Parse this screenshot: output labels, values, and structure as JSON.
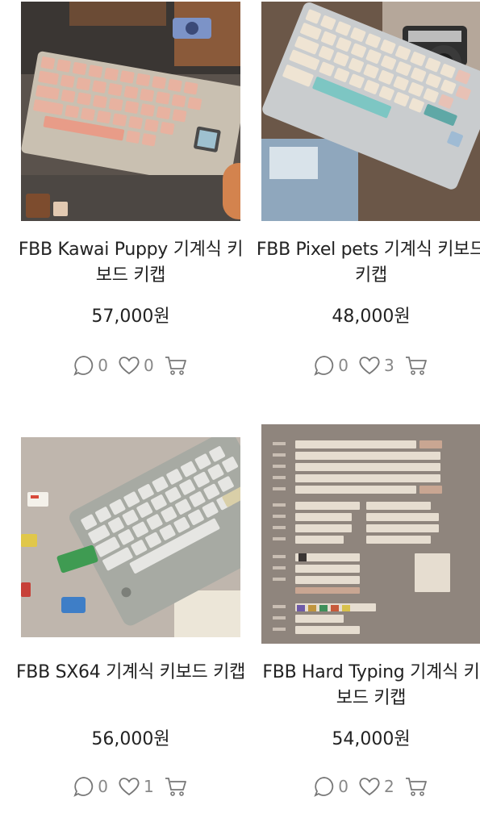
{
  "products": [
    {
      "title": "FBB Kawai Puppy 기계식 키보드 키캡",
      "price": "57,000원",
      "comments": "0",
      "likes": "0"
    },
    {
      "title": "FBB Pixel pets 기계식 키보드 키캡",
      "price": "48,000원",
      "comments": "0",
      "likes": "3"
    },
    {
      "title": "FBB SX64 기계식 키보드 키캡",
      "price": "56,000원",
      "comments": "0",
      "likes": "1"
    },
    {
      "title": "FBB Hard Typing 기계식 키보드 키캡",
      "price": "54,000원",
      "comments": "0",
      "likes": "2"
    }
  ],
  "icons": {
    "comment": "comment-icon",
    "like": "heart-icon",
    "cart": "cart-icon"
  },
  "colors": {
    "text": "#222222",
    "count": "#888888",
    "icon": "#777777"
  }
}
